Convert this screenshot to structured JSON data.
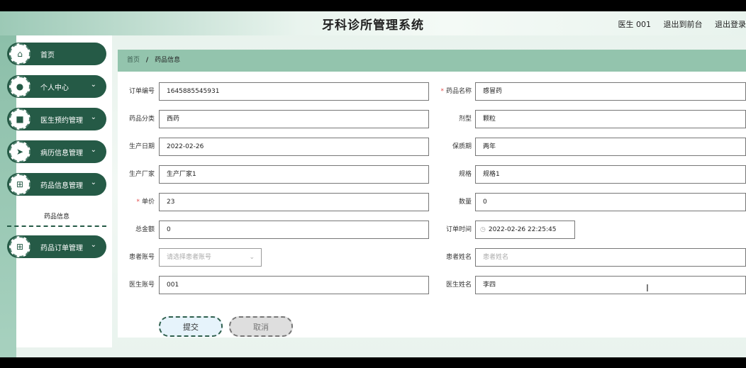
{
  "header": {
    "title": "牙科诊所管理系统",
    "user": "医生 001",
    "back_to_front": "退出到前台",
    "logout": "退出登录"
  },
  "sidebar": {
    "items": [
      {
        "label": "首页",
        "icon": "home-icon",
        "has_children": false
      },
      {
        "label": "个人中心",
        "icon": "person-icon",
        "has_children": true
      },
      {
        "label": "医生预约管理",
        "icon": "briefcase-icon",
        "has_children": true
      },
      {
        "label": "病历信息管理",
        "icon": "send-icon",
        "has_children": true
      },
      {
        "label": "药品信息管理",
        "icon": "grid-icon",
        "has_children": true
      },
      {
        "label": "药品订单管理",
        "icon": "grid-icon",
        "has_children": true
      }
    ],
    "submenu": {
      "label": "药品信息"
    }
  },
  "breadcrumb": {
    "home": "首页",
    "separator": "/",
    "current": "药品信息"
  },
  "form": {
    "order_no": {
      "label": "订单编号",
      "value": "1645885545931"
    },
    "drug_name": {
      "label": "药品名称",
      "value": "感冒药",
      "required": true
    },
    "drug_category": {
      "label": "药品分类",
      "value": "西药"
    },
    "dosage_form": {
      "label": "剂型",
      "value": "颗粒"
    },
    "production_date": {
      "label": "生产日期",
      "value": "2022-02-26"
    },
    "shelf_life": {
      "label": "保质期",
      "value": "两年"
    },
    "manufacturer": {
      "label": "生产厂家",
      "value": "生产厂家1"
    },
    "spec": {
      "label": "规格",
      "value": "规格1"
    },
    "unit_price": {
      "label": "单价",
      "value": "23",
      "required": true
    },
    "quantity": {
      "label": "数量",
      "value": "0"
    },
    "total": {
      "label": "总金额",
      "value": "0"
    },
    "order_time": {
      "label": "订单时间",
      "value": "2022-02-26 22:25:45"
    },
    "patient_account": {
      "label": "患者账号",
      "placeholder": "请选择患者账号"
    },
    "patient_name": {
      "label": "患者姓名",
      "placeholder": "患者姓名"
    },
    "doctor_account": {
      "label": "医生账号",
      "value": "001"
    },
    "doctor_name": {
      "label": "医生姓名",
      "value": "李四"
    }
  },
  "buttons": {
    "submit": "提交",
    "cancel": "取消"
  },
  "icons": {
    "required_mark": "*",
    "chevron": "chevron-down-icon",
    "clock": "clock-icon"
  },
  "colors": {
    "accent": "#255a46",
    "breadcrumb_bg": "#93c4ad",
    "required": "#e24c4c"
  }
}
